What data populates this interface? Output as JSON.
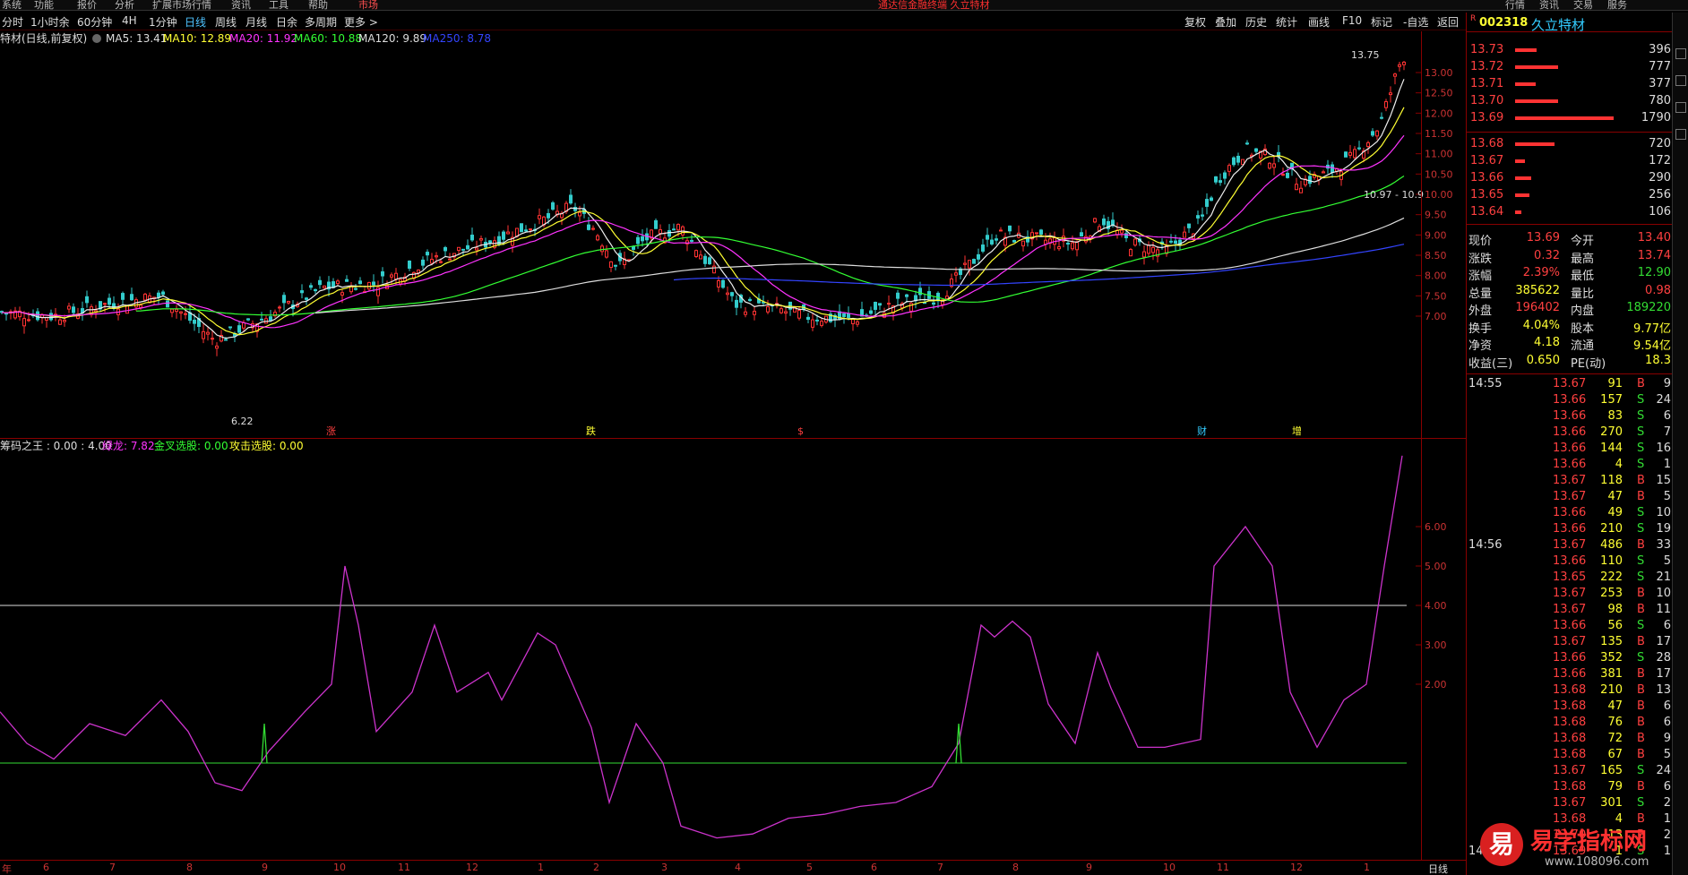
{
  "menu": {
    "items": [
      "系统",
      "功能",
      "报价",
      "分析",
      "扩展市场行情",
      "资讯",
      "工具",
      "帮助"
    ],
    "market_tab": "市场",
    "center_title": "通达信金融终端 久立特材",
    "right_items": [
      "行情",
      "资讯",
      "交易",
      "服务"
    ]
  },
  "periods": {
    "items": [
      "分时",
      "1小时余",
      "60分钟",
      "4H",
      "1分钟",
      "日线",
      "周线",
      "月线",
      "日余",
      "多周期",
      "更多 >"
    ],
    "active_index": 5
  },
  "tools": {
    "items": [
      "复权",
      "叠加",
      "历史",
      "统计",
      "画线",
      "F10",
      "标记",
      "-自选",
      "返回"
    ]
  },
  "main": {
    "legend": {
      "name": "特材(日线,前复权)",
      "ma5": "MA5: 13.41",
      "ma10": "MA10: 12.89",
      "ma20": "MA20: 11.92",
      "ma60": "MA60: 10.88",
      "ma120": "MA120: 9.89",
      "ma250": "MA250: 8.78"
    },
    "high_label": "13.75",
    "low_label": "6.22",
    "range_label": "10.97 - 10.9",
    "yticks": [
      "13.00",
      "12.50",
      "12.00",
      "11.50",
      "11.00",
      "10.50",
      "10.00",
      "9.50",
      "9.00",
      "8.50",
      "8.00",
      "7.50",
      "7.00"
    ],
    "event_markers": [
      "涨",
      "跌",
      "$",
      "财",
      "增"
    ]
  },
  "sub": {
    "legend": {
      "name": "筹码之王 : 0.00 : 4.00",
      "lvlong": "绿龙: 7.82",
      "jincha": "金叉选股: 0.00",
      "gongji": "攻击选股: 0.00"
    },
    "yticks": [
      "6.00",
      "5.00",
      "4.00",
      "3.00",
      "2.00"
    ]
  },
  "datebar": {
    "labels": [
      "年",
      "6",
      "7",
      "8",
      "9",
      "10",
      "11",
      "12",
      "1",
      "2",
      "3",
      "4",
      "5",
      "6",
      "7",
      "8",
      "9",
      "10",
      "11",
      "12",
      "1"
    ],
    "period_label": "日线"
  },
  "quote": {
    "code": "002318",
    "name": "久立特材",
    "sell": [
      {
        "price": "13.73",
        "vol": "396"
      },
      {
        "price": "13.72",
        "vol": "777"
      },
      {
        "price": "13.71",
        "vol": "377"
      },
      {
        "price": "13.70",
        "vol": "780"
      },
      {
        "price": "13.69",
        "vol": "1790"
      }
    ],
    "buy": [
      {
        "price": "13.68",
        "vol": "720"
      },
      {
        "price": "13.67",
        "vol": "172"
      },
      {
        "price": "13.66",
        "vol": "290"
      },
      {
        "price": "13.65",
        "vol": "256"
      },
      {
        "price": "13.64",
        "vol": "106"
      }
    ],
    "stats": [
      {
        "l": "现价",
        "v": "13.69",
        "l2": "今开",
        "v2": "13.40"
      },
      {
        "l": "涨跌",
        "v": "0.32",
        "l2": "最高",
        "v2": "13.74"
      },
      {
        "l": "涨幅",
        "v": "2.39%",
        "l2": "最低",
        "v2": "12.90"
      },
      {
        "l": "总量",
        "v": "385622",
        "l2": "量比",
        "v2": "0.98"
      },
      {
        "l": "外盘",
        "v": "196402",
        "l2": "内盘",
        "v2": "189220"
      },
      {
        "l": "换手",
        "v": "4.04%",
        "l2": "股本",
        "v2": "9.77亿"
      },
      {
        "l": "净资",
        "v": "4.18",
        "l2": "流通",
        "v2": "9.54亿"
      },
      {
        "l": "收益(三)",
        "v": "0.650",
        "l2": "PE(动)",
        "v2": "18.3"
      }
    ],
    "time1": "14:55",
    "time2": "14:56",
    "time3": "14:5",
    "ticks": [
      [
        "13.67",
        "91",
        "B",
        "9"
      ],
      [
        "13.66",
        "157",
        "S",
        "24"
      ],
      [
        "13.66",
        "83",
        "S",
        "6"
      ],
      [
        "13.66",
        "270",
        "S",
        "7"
      ],
      [
        "13.66",
        "144",
        "S",
        "16"
      ],
      [
        "13.66",
        "4",
        "S",
        "1"
      ],
      [
        "13.67",
        "118",
        "B",
        "15"
      ],
      [
        "13.67",
        "47",
        "B",
        "5"
      ],
      [
        "13.66",
        "49",
        "S",
        "10"
      ],
      [
        "13.66",
        "210",
        "S",
        "19"
      ],
      [
        "13.67",
        "486",
        "B",
        "33"
      ],
      [
        "13.66",
        "110",
        "S",
        "5"
      ],
      [
        "13.65",
        "222",
        "S",
        "21"
      ],
      [
        "13.67",
        "253",
        "B",
        "10"
      ],
      [
        "13.67",
        "98",
        "B",
        "11"
      ],
      [
        "13.66",
        "56",
        "S",
        "6"
      ],
      [
        "13.67",
        "135",
        "B",
        "17"
      ],
      [
        "13.66",
        "352",
        "S",
        "28"
      ],
      [
        "13.66",
        "381",
        "B",
        "17"
      ],
      [
        "13.68",
        "210",
        "B",
        "13"
      ],
      [
        "13.68",
        "47",
        "B",
        "6"
      ],
      [
        "13.68",
        "76",
        "B",
        "6"
      ],
      [
        "13.68",
        "72",
        "B",
        "9"
      ],
      [
        "13.68",
        "67",
        "B",
        "5"
      ],
      [
        "13.67",
        "165",
        "S",
        "24"
      ],
      [
        "13.68",
        "79",
        "B",
        "6"
      ],
      [
        "13.67",
        "301",
        "S",
        "2"
      ],
      [
        "13.68",
        "4",
        "B",
        "1"
      ],
      [
        "13.70",
        "13",
        "B",
        "2"
      ],
      [
        "13.69",
        "1",
        "S",
        "1"
      ]
    ]
  },
  "watermark": {
    "logo_char": "易",
    "title": "易学指标网",
    "url": "www.108096.com"
  }
}
